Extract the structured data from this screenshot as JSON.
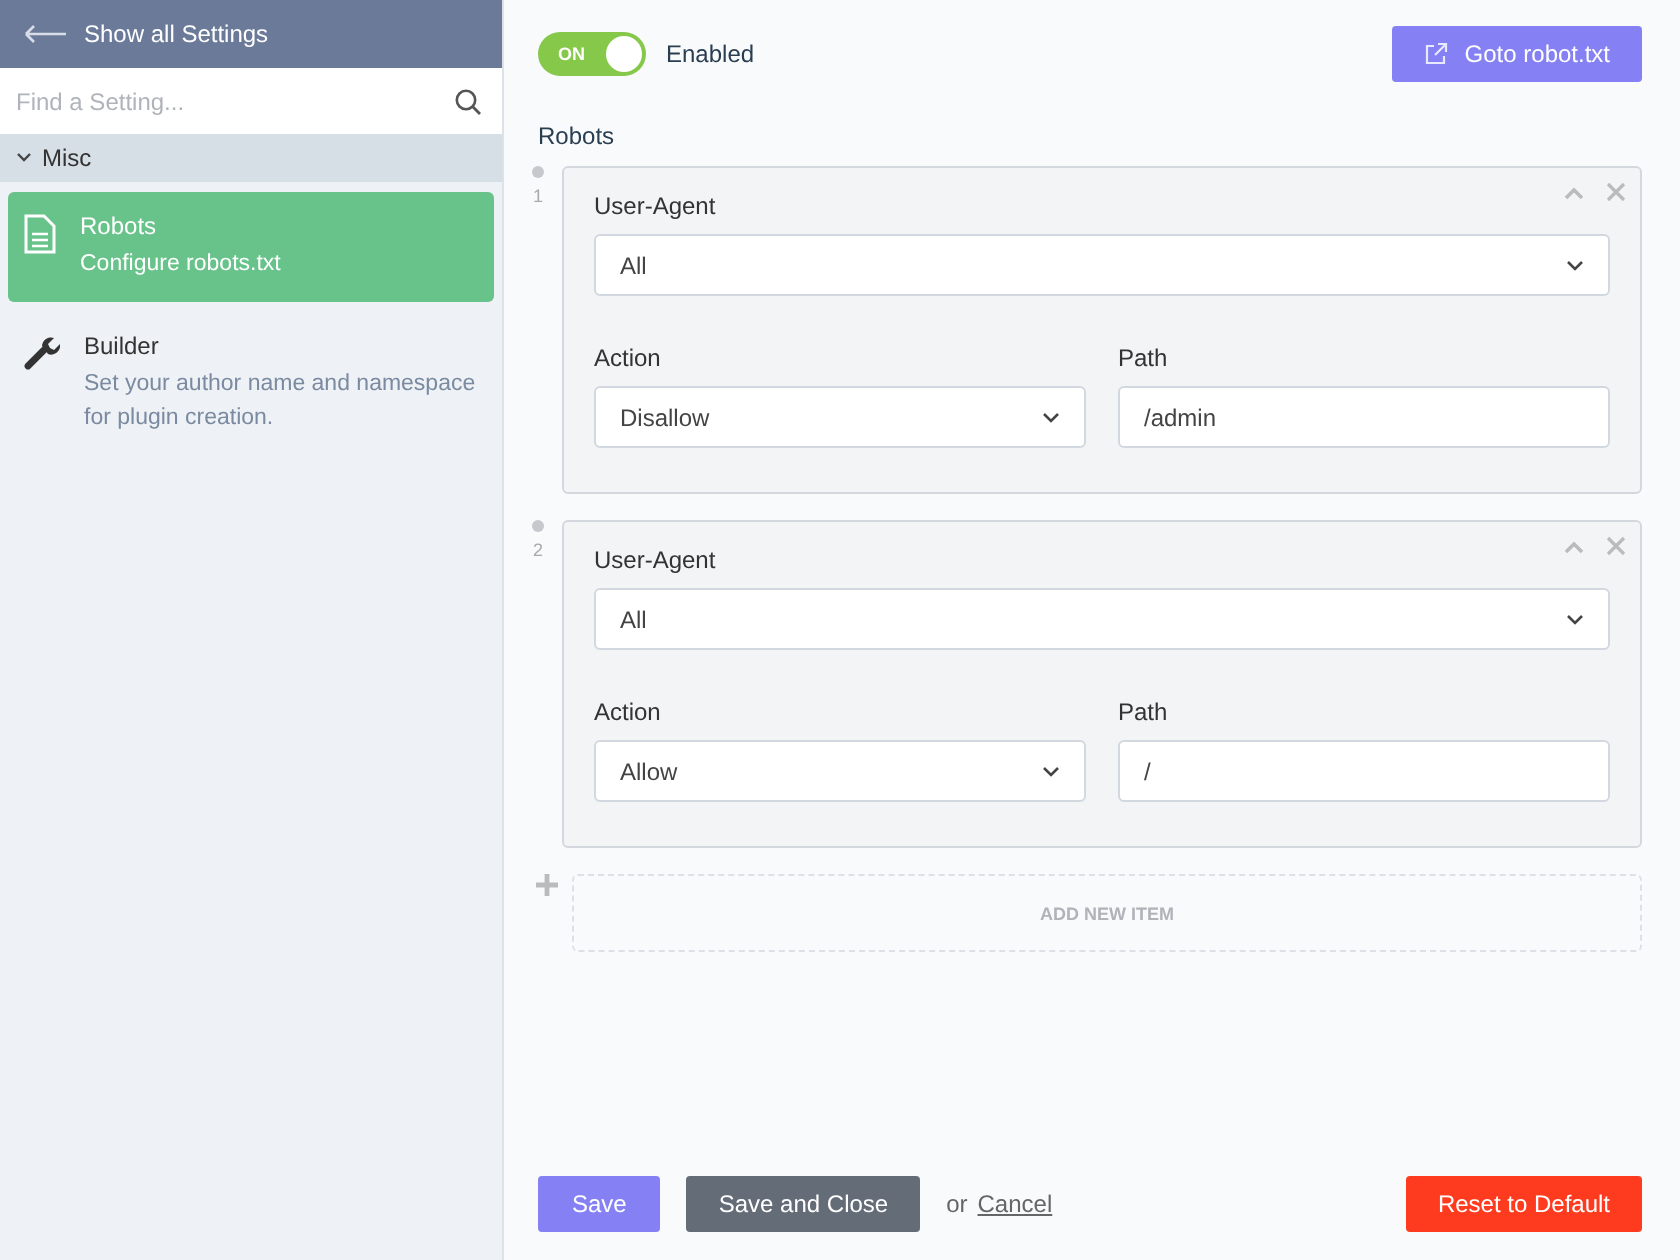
{
  "sidebar": {
    "back_link": "Show all Settings",
    "search": {
      "placeholder": "Find a Setting..."
    },
    "section": {
      "label": "Misc",
      "expanded": true
    },
    "items": [
      {
        "kind": "document",
        "title": "Robots",
        "description": "Configure robots.txt",
        "selected": true
      },
      {
        "kind": "wrench",
        "title": "Builder",
        "description": "Set your author name and namespace for plugin creation.",
        "selected": false
      }
    ]
  },
  "toggle": {
    "label": "ON",
    "on": true,
    "caption": "Enabled"
  },
  "goto_button": "Goto robot.txt",
  "repeater": {
    "label": "Robots",
    "items": [
      {
        "index": "1",
        "user_agent_label": "User-Agent",
        "user_agent": "All",
        "action_label": "Action",
        "action": "Disallow",
        "path_label": "Path",
        "path": "/admin"
      },
      {
        "index": "2",
        "user_agent_label": "User-Agent",
        "user_agent": "All",
        "action_label": "Action",
        "action": "Allow",
        "path_label": "Path",
        "path": "/"
      }
    ],
    "add_button": "ADD NEW ITEM"
  },
  "footer": {
    "save": "Save",
    "save_close": "Save and Close",
    "or": "or",
    "cancel": "Cancel",
    "reset": "Reset to Default"
  }
}
